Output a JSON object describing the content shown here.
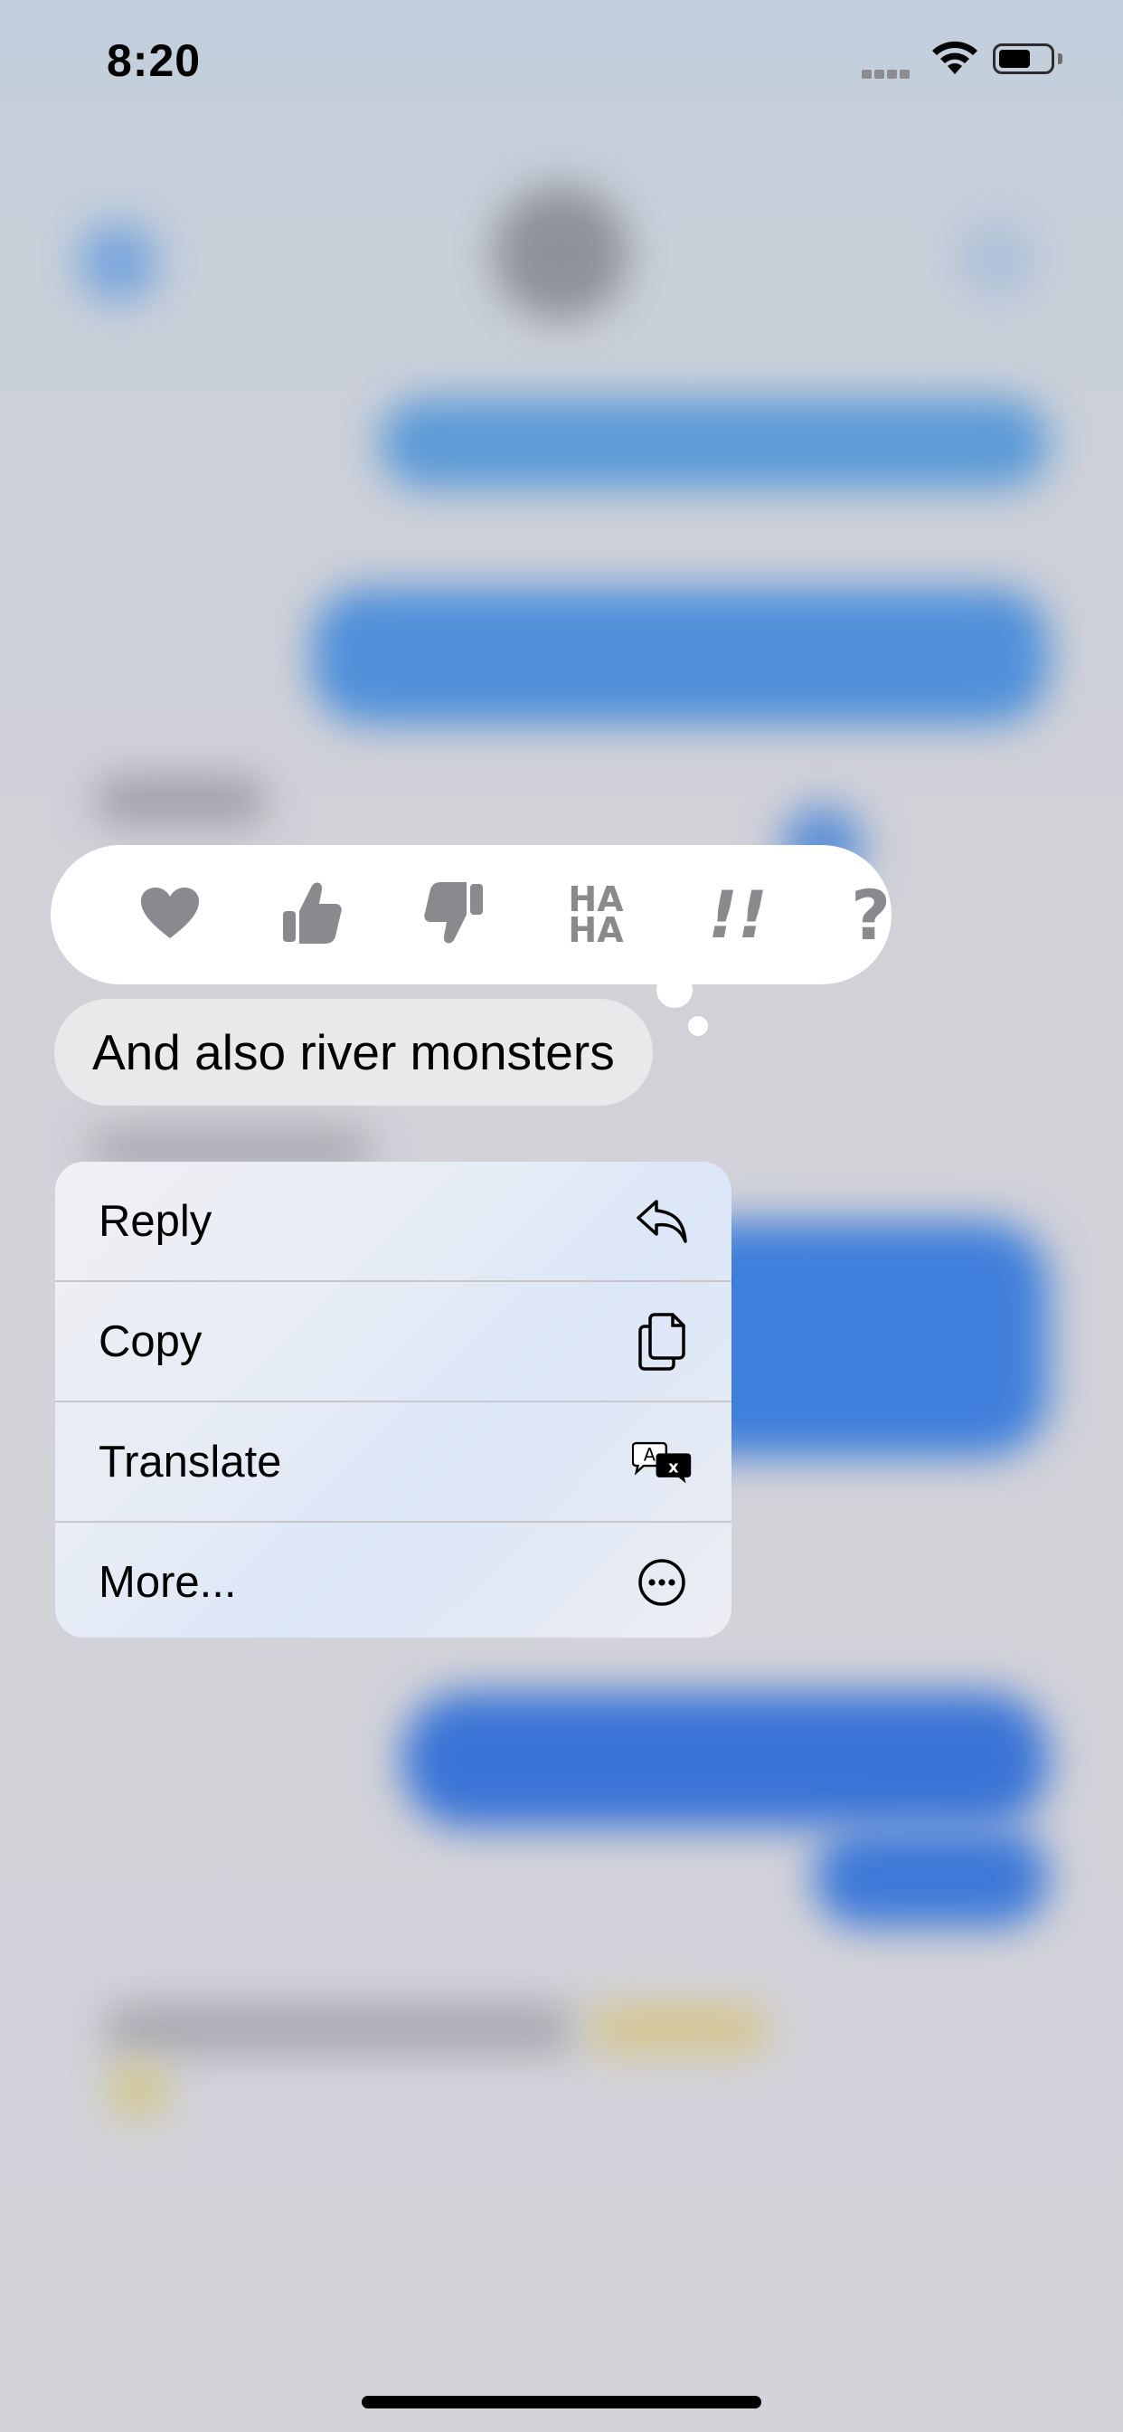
{
  "status_bar": {
    "time": "8:20"
  },
  "reactions": [
    {
      "name": "heart",
      "label": ""
    },
    {
      "name": "thumbs-up",
      "label": ""
    },
    {
      "name": "thumbs-down",
      "label": ""
    },
    {
      "name": "haha",
      "label": "HA HA"
    },
    {
      "name": "exclamation",
      "label": "!!"
    },
    {
      "name": "question",
      "label": "?"
    }
  ],
  "message": {
    "text": "And also river monsters"
  },
  "menu": {
    "items": [
      {
        "label": "Reply",
        "icon": "reply-arrow-icon"
      },
      {
        "label": "Copy",
        "icon": "copy-documents-icon"
      },
      {
        "label": "Translate",
        "icon": "translate-bubbles-icon"
      },
      {
        "label": "More...",
        "icon": "ellipsis-circle-icon"
      }
    ]
  },
  "colors": {
    "reaction_gray": "#8a8a8e",
    "bubble_gray": "#e9e9eb",
    "blurred_bubble_blue": "#3f7fdb"
  }
}
